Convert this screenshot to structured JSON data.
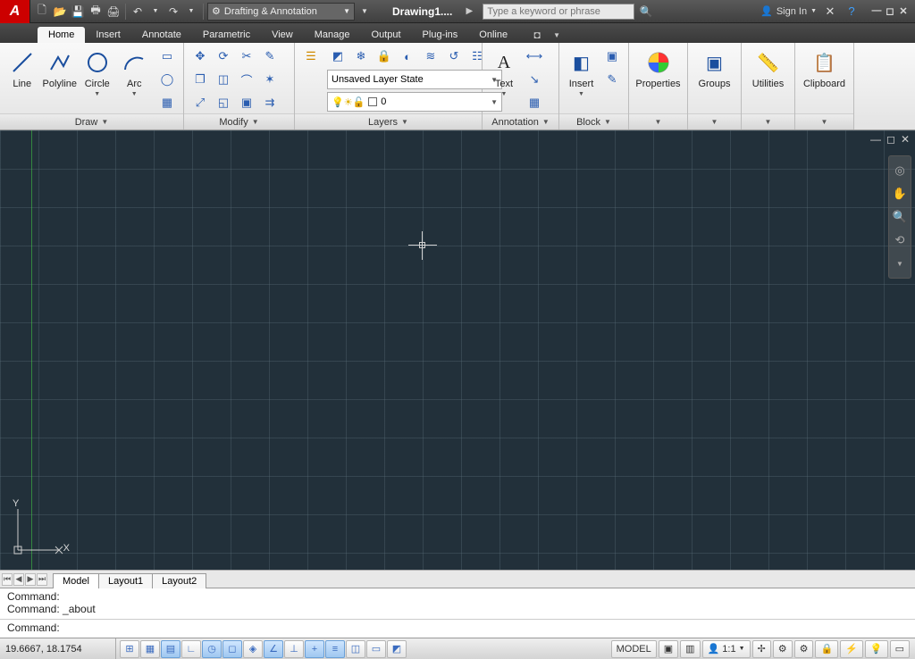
{
  "app": {
    "letter": "A"
  },
  "qat": {
    "workspace": "Drafting & Annotation",
    "doc_title": "Drawing1....",
    "search_placeholder": "Type a keyword or phrase",
    "signin": "Sign In"
  },
  "tabs": {
    "items": [
      "Home",
      "Insert",
      "Annotate",
      "Parametric",
      "View",
      "Manage",
      "Output",
      "Plug-ins",
      "Online"
    ],
    "active": 0
  },
  "ribbon": {
    "draw": {
      "title": "Draw",
      "tools": {
        "line": "Line",
        "polyline": "Polyline",
        "circle": "Circle",
        "arc": "Arc"
      }
    },
    "modify": {
      "title": "Modify"
    },
    "layers": {
      "title": "Layers",
      "state": "Unsaved Layer State",
      "current": "0"
    },
    "annotation": {
      "title": "Annotation",
      "text": "Text"
    },
    "block": {
      "title": "Block",
      "insert": "Insert"
    },
    "properties": {
      "title": "Properties"
    },
    "groups": {
      "title": "Groups"
    },
    "utilities": {
      "title": "Utilities"
    },
    "clipboard": {
      "title": "Clipboard"
    }
  },
  "canvas": {
    "ucs_x": "X",
    "ucs_y": "Y"
  },
  "layout": {
    "tabs": [
      "Model",
      "Layout1",
      "Layout2"
    ],
    "active": 0
  },
  "cmd": {
    "line1": "Command:",
    "line2": "Command: _about",
    "prompt": "Command:"
  },
  "status": {
    "coords": "19.6667, 18.1754",
    "model": "MODEL",
    "scale": "1:1"
  }
}
